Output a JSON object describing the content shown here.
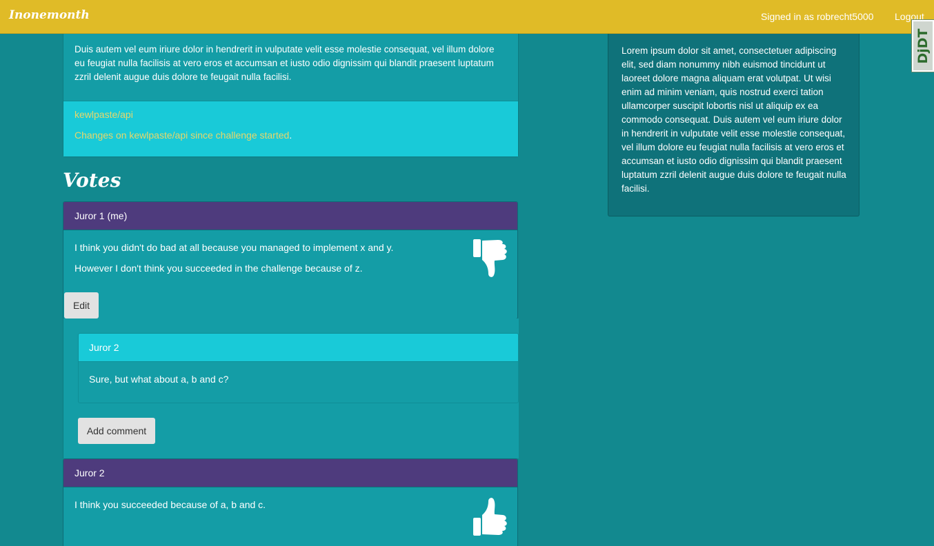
{
  "navbar": {
    "brand": "Inonemonth",
    "signed_in": "Signed in as robrecht5000",
    "logout": "Logout"
  },
  "debug_toolbar": {
    "label": "DjDT"
  },
  "challenge": {
    "body": "Duis autem vel eum iriure dolor in hendrerit in vulputate velit esse molestie consequat, vel illum dolore eu feugiat nulla facilisis at vero eros et accumsan et iusto odio dignissim qui blandit praesent luptatum zzril delenit augue duis dolore te feugait nulla facilisi.",
    "repo": "kewlpaste/api",
    "changes_link": "Changes on kewlpaste/api since challenge started",
    "changes_suffix": "."
  },
  "votes": {
    "title": "Votes",
    "items": [
      {
        "juror": "Juror 1 (me)",
        "lines": [
          "I think you didn't do bad at all because you managed to implement x and y.",
          "However I don't think you succeeded in the challenge because of z."
        ],
        "verdict_icon": "thumbs-down-icon",
        "edit_label": "Edit"
      },
      {
        "juror": "Juror 2",
        "lines": [
          "I think you succeeded because of a, b and c."
        ],
        "verdict_icon": "thumbs-up-icon"
      }
    ],
    "comments": [
      {
        "juror": "Juror 2",
        "text": "Sure, but what about a, b and c?"
      }
    ],
    "add_comment_label": "Add comment"
  },
  "sidebar": {
    "text": "Lorem ipsum dolor sit amet, consectetuer adipiscing elit, sed diam nonummy nibh euismod tincidunt ut laoreet dolore magna aliquam erat volutpat. Ut wisi enim ad minim veniam, quis nostrud exerci tation ullamcorper suscipit lobortis nisl ut aliquip ex ea commodo consequat. Duis autem vel eum iriure dolor in hendrerit in vulputate velit esse molestie consequat, vel illum dolore eu feugiat nulla facilisis at vero eros et accumsan et iusto odio dignissim qui blandit praesent luptatum zzril delenit augue duis dolore te feugait nulla facilisi."
  },
  "colors": {
    "navbar": "#e0bb27",
    "page_background": "#12898f",
    "vote_header": "#4e3b7d",
    "accent_cyan": "#19cad8",
    "link_yellow": "#e7d76a"
  }
}
